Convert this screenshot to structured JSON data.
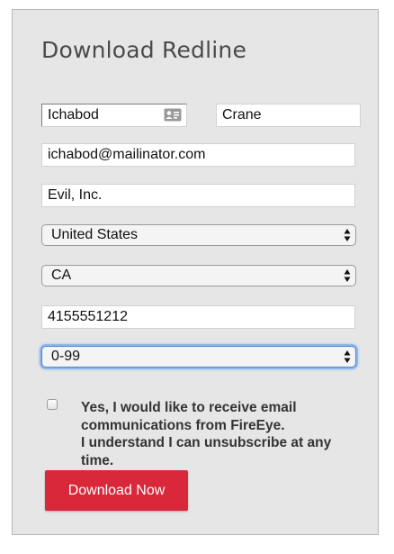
{
  "form": {
    "title": "Download Redline",
    "first_name": "Ichabod",
    "last_name": "Crane",
    "email": "ichabod@mailinator.com",
    "company": "Evil, Inc.",
    "country": "United States",
    "state": "CA",
    "phone": "4155551212",
    "employees": "0-99",
    "consent_line1": "Yes, I would like to receive email communications from FireEye.",
    "consent_line2": "I understand I can unsubscribe at any time.",
    "consent_checked": false,
    "submit_label": "Download Now",
    "submit_color": "#d8283a"
  },
  "icons": {
    "autofill": "contact-card-icon",
    "select_arrows": "chevron-up-down-icon"
  }
}
